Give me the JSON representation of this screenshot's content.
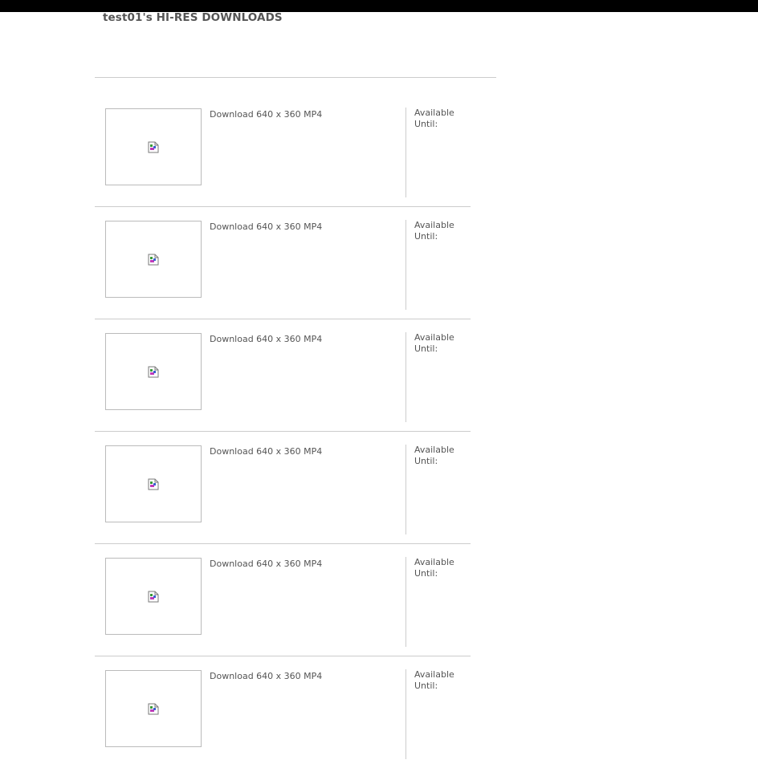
{
  "page": {
    "title": "test01's HI-RES DOWNLOADS"
  },
  "downloads": [
    {
      "link_label": "Download 640 x 360 MP4",
      "available_label": "Available",
      "until_label": "Until:",
      "thumbnail_icon": "broken-image-icon"
    },
    {
      "link_label": "Download 640 x 360 MP4",
      "available_label": "Available",
      "until_label": "Until:",
      "thumbnail_icon": "broken-image-icon"
    },
    {
      "link_label": "Download 640 x 360 MP4",
      "available_label": "Available",
      "until_label": "Until:",
      "thumbnail_icon": "broken-image-icon"
    },
    {
      "link_label": "Download 640 x 360 MP4",
      "available_label": "Available",
      "until_label": "Until:",
      "thumbnail_icon": "broken-image-icon"
    },
    {
      "link_label": "Download 640 x 360 MP4",
      "available_label": "Available",
      "until_label": "Until:",
      "thumbnail_icon": "broken-image-icon"
    },
    {
      "link_label": "Download 640 x 360 MP4",
      "available_label": "Available",
      "until_label": "Until:",
      "thumbnail_icon": "broken-image-icon"
    }
  ],
  "colors": {
    "top_bar": "#000000",
    "text": "#555555",
    "rule": "#cccccc"
  }
}
